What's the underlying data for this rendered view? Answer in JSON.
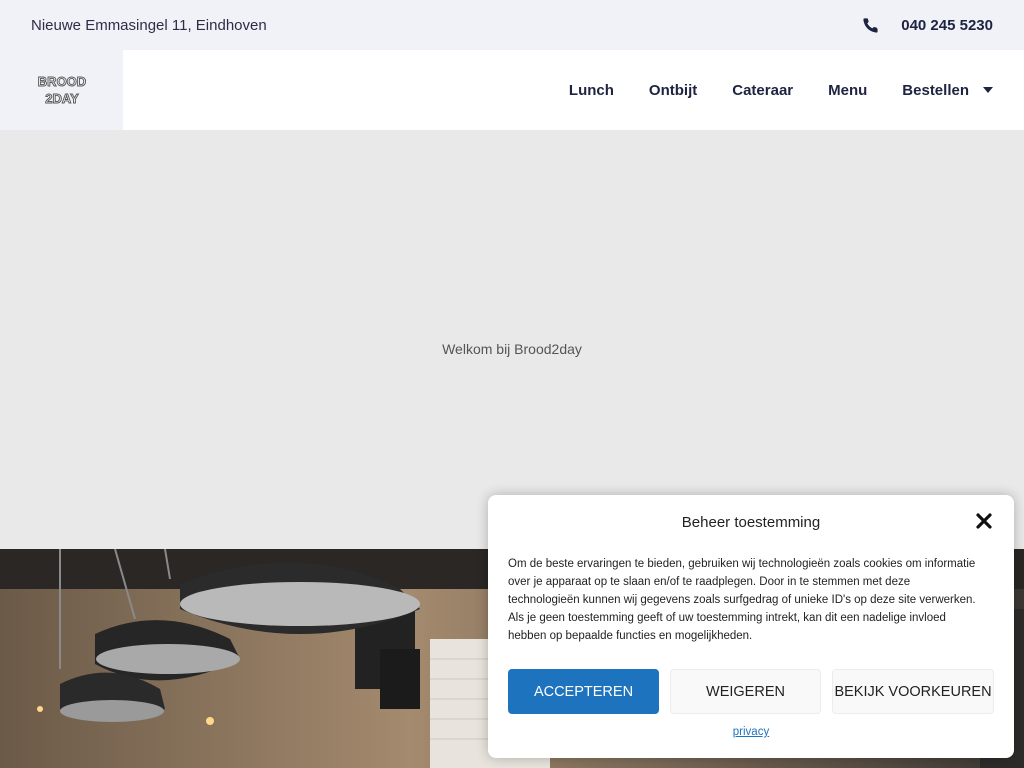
{
  "topbar": {
    "address": "Nieuwe Emmasingel 11, Eindhoven",
    "phone": "040 245 5230",
    "phone_icon": "phone-icon"
  },
  "header": {
    "logo_text_line1": "BROOD",
    "logo_text_line2": "2DAY",
    "nav": [
      {
        "label": "Lunch"
      },
      {
        "label": "Ontbijt"
      },
      {
        "label": "Cateraar"
      },
      {
        "label": "Menu"
      },
      {
        "label": "Bestellen",
        "has_dropdown": true
      }
    ]
  },
  "hero": {
    "text": "Welkom bij Brood2day"
  },
  "consent": {
    "title": "Beheer toestemming",
    "body": "Om de beste ervaringen te bieden, gebruiken wij technologieën zoals cookies om informatie over je apparaat op te slaan en/of te raadplegen. Door in te stemmen met deze technologieën kunnen wij gegevens zoals surfgedrag of unieke ID's op deze site verwerken. Als je geen toestemming geeft of uw toestemming intrekt, kan dit een nadelige invloed hebben op bepaalde functies en mogelijkheden.",
    "accept_label": "ACCEPTEREN",
    "deny_label": "WEIGEREN",
    "prefs_label": "BEKIJK VOORKEUREN",
    "privacy_label": "privacy"
  },
  "colors": {
    "accent": "#1e73be",
    "nav_text": "#1e2340",
    "topbar_bg": "#f0f2f7",
    "hero_bg": "#e9e9e9"
  }
}
